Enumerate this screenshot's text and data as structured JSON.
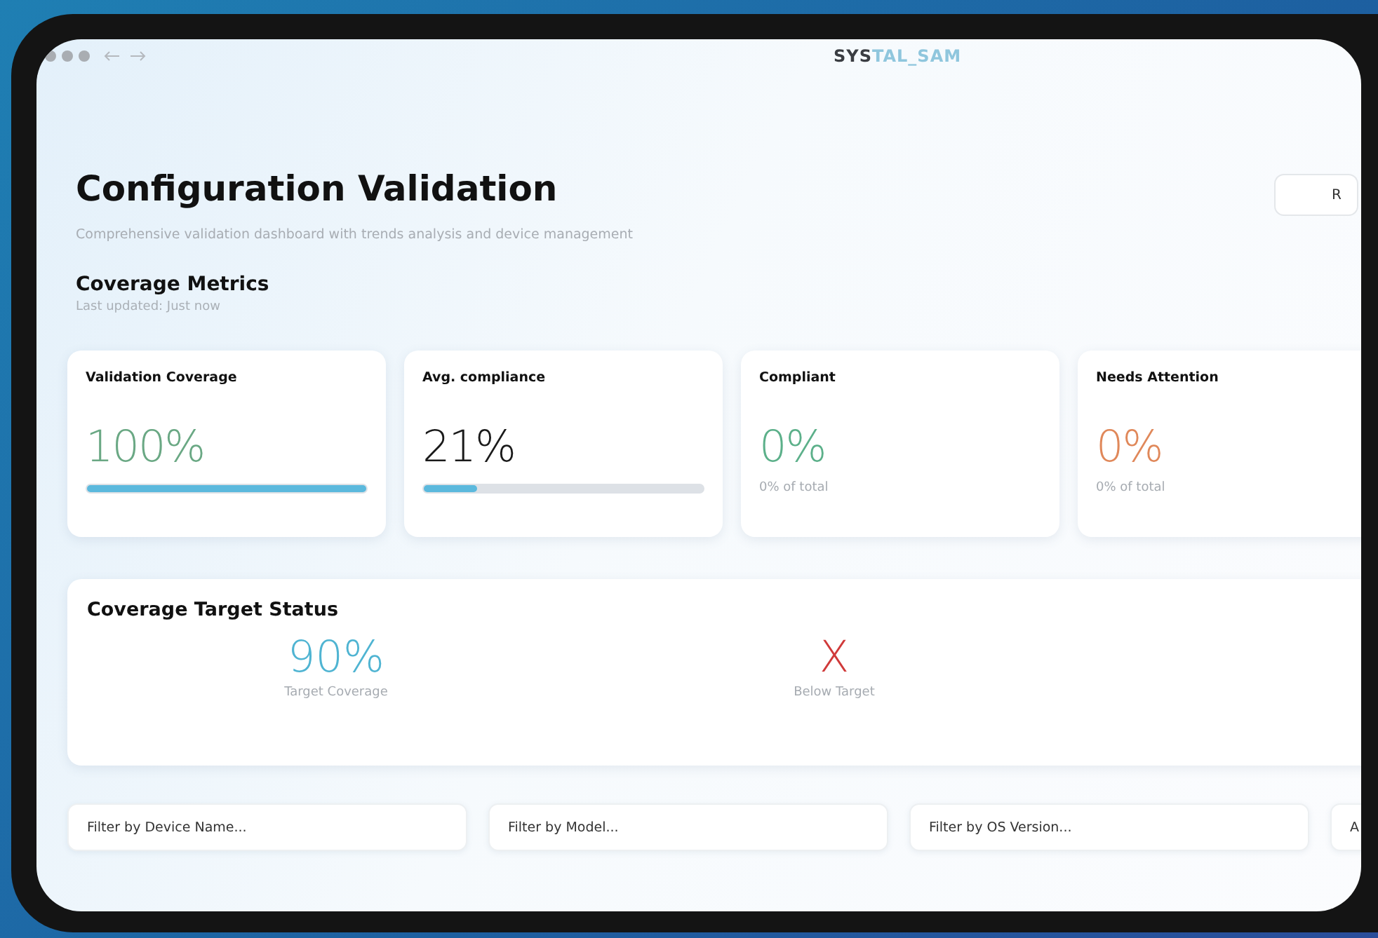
{
  "window": {
    "logo": {
      "dark": "SYS",
      "light": "TAL_SAM"
    }
  },
  "page": {
    "title": "Configuration Validation",
    "subtitle": "Comprehensive validation dashboard with trends analysis and device management",
    "action_button": "R"
  },
  "metrics": {
    "title": "Coverage Metrics",
    "updated": "Last updated: Just now",
    "cards": [
      {
        "kind": "bar",
        "label": "Validation Coverage",
        "value": "100%",
        "color": "#6aa884",
        "level": 1
      },
      {
        "kind": "bar",
        "label": "Avg. compliance",
        "value": "21%",
        "color": "#1a1a1a",
        "level": 0.19
      },
      {
        "kind": "subtext",
        "label": "Compliant",
        "value": "0%",
        "color": "#5cb08a",
        "subtext": "0% of total"
      },
      {
        "kind": "subtext",
        "label": "Needs Attention",
        "value": "0%",
        "color": "#e0885a",
        "subtext": "0% of total"
      }
    ]
  },
  "target_status": {
    "title": "Coverage Target Status",
    "stats": [
      {
        "value": "90%",
        "label": "Target Coverage",
        "color": "#4fb4d2"
      },
      {
        "value": "X",
        "label": "Below Target",
        "color": "#d03a3a"
      }
    ]
  },
  "filters": [
    {
      "placeholder": "Filter by Device Name..."
    },
    {
      "placeholder": "Filter by Model..."
    },
    {
      "placeholder": "Filter by OS Version..."
    },
    {
      "placeholder": "A"
    }
  ]
}
